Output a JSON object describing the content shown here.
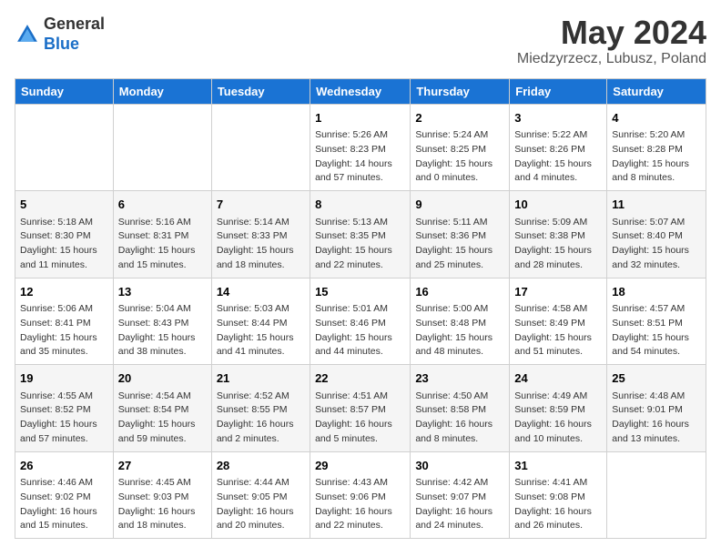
{
  "header": {
    "logo_general": "General",
    "logo_blue": "Blue",
    "month_title": "May 2024",
    "location": "Miedzyrzecz, Lubusz, Poland"
  },
  "days_of_week": [
    "Sunday",
    "Monday",
    "Tuesday",
    "Wednesday",
    "Thursday",
    "Friday",
    "Saturday"
  ],
  "weeks": [
    [
      {
        "day": "",
        "info": ""
      },
      {
        "day": "",
        "info": ""
      },
      {
        "day": "",
        "info": ""
      },
      {
        "day": "1",
        "info": "Sunrise: 5:26 AM\nSunset: 8:23 PM\nDaylight: 14 hours\nand 57 minutes."
      },
      {
        "day": "2",
        "info": "Sunrise: 5:24 AM\nSunset: 8:25 PM\nDaylight: 15 hours\nand 0 minutes."
      },
      {
        "day": "3",
        "info": "Sunrise: 5:22 AM\nSunset: 8:26 PM\nDaylight: 15 hours\nand 4 minutes."
      },
      {
        "day": "4",
        "info": "Sunrise: 5:20 AM\nSunset: 8:28 PM\nDaylight: 15 hours\nand 8 minutes."
      }
    ],
    [
      {
        "day": "5",
        "info": "Sunrise: 5:18 AM\nSunset: 8:30 PM\nDaylight: 15 hours\nand 11 minutes."
      },
      {
        "day": "6",
        "info": "Sunrise: 5:16 AM\nSunset: 8:31 PM\nDaylight: 15 hours\nand 15 minutes."
      },
      {
        "day": "7",
        "info": "Sunrise: 5:14 AM\nSunset: 8:33 PM\nDaylight: 15 hours\nand 18 minutes."
      },
      {
        "day": "8",
        "info": "Sunrise: 5:13 AM\nSunset: 8:35 PM\nDaylight: 15 hours\nand 22 minutes."
      },
      {
        "day": "9",
        "info": "Sunrise: 5:11 AM\nSunset: 8:36 PM\nDaylight: 15 hours\nand 25 minutes."
      },
      {
        "day": "10",
        "info": "Sunrise: 5:09 AM\nSunset: 8:38 PM\nDaylight: 15 hours\nand 28 minutes."
      },
      {
        "day": "11",
        "info": "Sunrise: 5:07 AM\nSunset: 8:40 PM\nDaylight: 15 hours\nand 32 minutes."
      }
    ],
    [
      {
        "day": "12",
        "info": "Sunrise: 5:06 AM\nSunset: 8:41 PM\nDaylight: 15 hours\nand 35 minutes."
      },
      {
        "day": "13",
        "info": "Sunrise: 5:04 AM\nSunset: 8:43 PM\nDaylight: 15 hours\nand 38 minutes."
      },
      {
        "day": "14",
        "info": "Sunrise: 5:03 AM\nSunset: 8:44 PM\nDaylight: 15 hours\nand 41 minutes."
      },
      {
        "day": "15",
        "info": "Sunrise: 5:01 AM\nSunset: 8:46 PM\nDaylight: 15 hours\nand 44 minutes."
      },
      {
        "day": "16",
        "info": "Sunrise: 5:00 AM\nSunset: 8:48 PM\nDaylight: 15 hours\nand 48 minutes."
      },
      {
        "day": "17",
        "info": "Sunrise: 4:58 AM\nSunset: 8:49 PM\nDaylight: 15 hours\nand 51 minutes."
      },
      {
        "day": "18",
        "info": "Sunrise: 4:57 AM\nSunset: 8:51 PM\nDaylight: 15 hours\nand 54 minutes."
      }
    ],
    [
      {
        "day": "19",
        "info": "Sunrise: 4:55 AM\nSunset: 8:52 PM\nDaylight: 15 hours\nand 57 minutes."
      },
      {
        "day": "20",
        "info": "Sunrise: 4:54 AM\nSunset: 8:54 PM\nDaylight: 15 hours\nand 59 minutes."
      },
      {
        "day": "21",
        "info": "Sunrise: 4:52 AM\nSunset: 8:55 PM\nDaylight: 16 hours\nand 2 minutes."
      },
      {
        "day": "22",
        "info": "Sunrise: 4:51 AM\nSunset: 8:57 PM\nDaylight: 16 hours\nand 5 minutes."
      },
      {
        "day": "23",
        "info": "Sunrise: 4:50 AM\nSunset: 8:58 PM\nDaylight: 16 hours\nand 8 minutes."
      },
      {
        "day": "24",
        "info": "Sunrise: 4:49 AM\nSunset: 8:59 PM\nDaylight: 16 hours\nand 10 minutes."
      },
      {
        "day": "25",
        "info": "Sunrise: 4:48 AM\nSunset: 9:01 PM\nDaylight: 16 hours\nand 13 minutes."
      }
    ],
    [
      {
        "day": "26",
        "info": "Sunrise: 4:46 AM\nSunset: 9:02 PM\nDaylight: 16 hours\nand 15 minutes."
      },
      {
        "day": "27",
        "info": "Sunrise: 4:45 AM\nSunset: 9:03 PM\nDaylight: 16 hours\nand 18 minutes."
      },
      {
        "day": "28",
        "info": "Sunrise: 4:44 AM\nSunset: 9:05 PM\nDaylight: 16 hours\nand 20 minutes."
      },
      {
        "day": "29",
        "info": "Sunrise: 4:43 AM\nSunset: 9:06 PM\nDaylight: 16 hours\nand 22 minutes."
      },
      {
        "day": "30",
        "info": "Sunrise: 4:42 AM\nSunset: 9:07 PM\nDaylight: 16 hours\nand 24 minutes."
      },
      {
        "day": "31",
        "info": "Sunrise: 4:41 AM\nSunset: 9:08 PM\nDaylight: 16 hours\nand 26 minutes."
      },
      {
        "day": "",
        "info": ""
      }
    ]
  ]
}
